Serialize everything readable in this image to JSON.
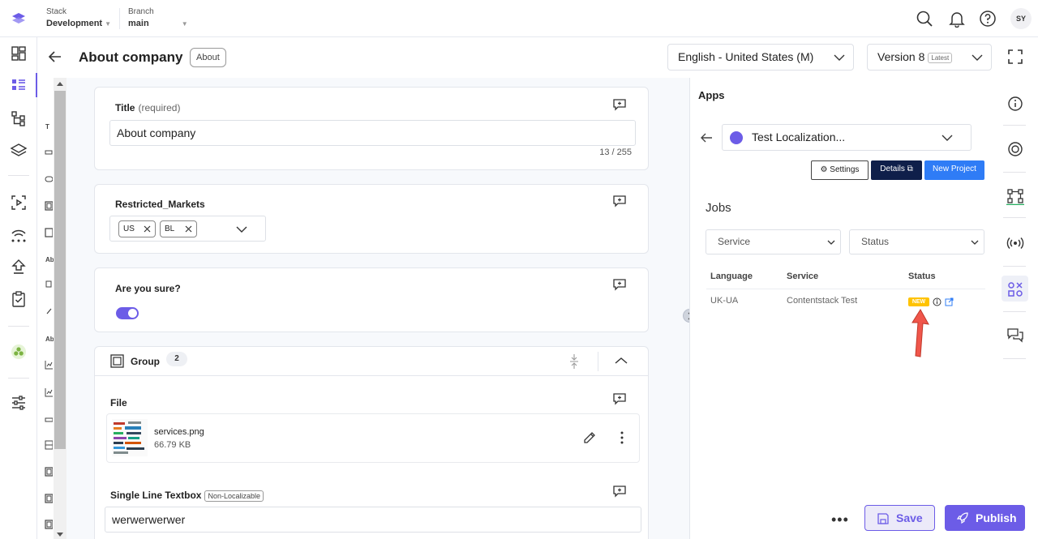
{
  "topbar": {
    "stack_label": "Stack",
    "stack_value": "Development",
    "branch_label": "Branch",
    "branch_value": "main",
    "avatar_initials": "SY"
  },
  "header": {
    "title": "About company",
    "content_type_tag": "About",
    "locale": "English - United States (M)",
    "version_label": "Version 8",
    "version_badge": "Latest"
  },
  "field_strip": {
    "icons": [
      "T",
      "Ab",
      "Ab"
    ]
  },
  "fields": {
    "title": {
      "label": "Title",
      "hint": "(required)",
      "value": "About company",
      "counter": "13 / 255"
    },
    "restricted_markets": {
      "label": "Restricted_Markets",
      "chips": [
        "US",
        "BL"
      ]
    },
    "are_you_sure": {
      "label": "Are you sure?",
      "value": true
    },
    "group": {
      "label": "Group",
      "count": "2"
    },
    "file": {
      "label": "File",
      "filename": "services.png",
      "filesize": "66.79 KB"
    },
    "single_line": {
      "label": "Single Line Textbox",
      "badge": "Non-Localizable",
      "value": "werwerwerwer"
    }
  },
  "apps_panel": {
    "title": "Apps",
    "selected_app": "Test Localization...",
    "buttons": {
      "settings": "Settings",
      "details": "Details",
      "new_project": "New Project"
    },
    "jobs_title": "Jobs",
    "service_filter": "Service",
    "status_filter": "Status",
    "columns": [
      "Language",
      "Service",
      "Status"
    ],
    "rows": [
      {
        "language": "UK-UA",
        "service": "Contentstack Test",
        "status": "NEW"
      }
    ]
  },
  "footer": {
    "save_label": "Save",
    "publish_label": "Publish"
  },
  "colors": {
    "accent": "#6c5ce7",
    "details_button": "#0f1f4a",
    "new_project_button": "#2f7cf6",
    "status_new": "#ffc300",
    "annotation_arrow": "#f0564b"
  }
}
